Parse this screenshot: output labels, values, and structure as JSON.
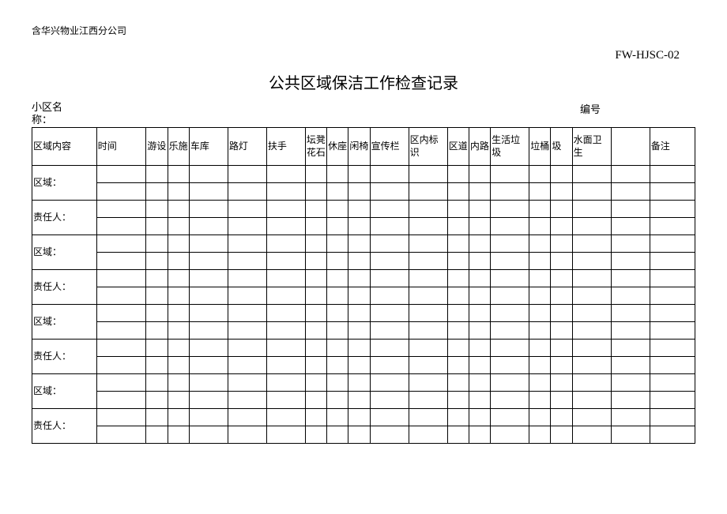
{
  "header": {
    "org": "含华兴物业江西分公司",
    "doc_code": "FW-HJSC-02",
    "title": "公共区域保洁工作检查记录",
    "community_label": "小区名称：",
    "number_label": "编号"
  },
  "columns": {
    "c0": "区域内容",
    "c1": "时间",
    "c2": "游设",
    "c3": "乐施",
    "c4": "车库",
    "c5": "路灯",
    "c6": "扶手",
    "c7": "坛凳花石",
    "c8": "休座",
    "c9": "闲椅",
    "c10": "宣传栏",
    "c11": "区内标识",
    "c12": "区道",
    "c13": "内路",
    "c14": "生活垃圾",
    "c15": "垃桶",
    "c16": "圾",
    "c17": "水面卫生",
    "c18": "",
    "c19": "备注"
  },
  "rows": {
    "area": "区域：",
    "responsible": "责任人："
  }
}
